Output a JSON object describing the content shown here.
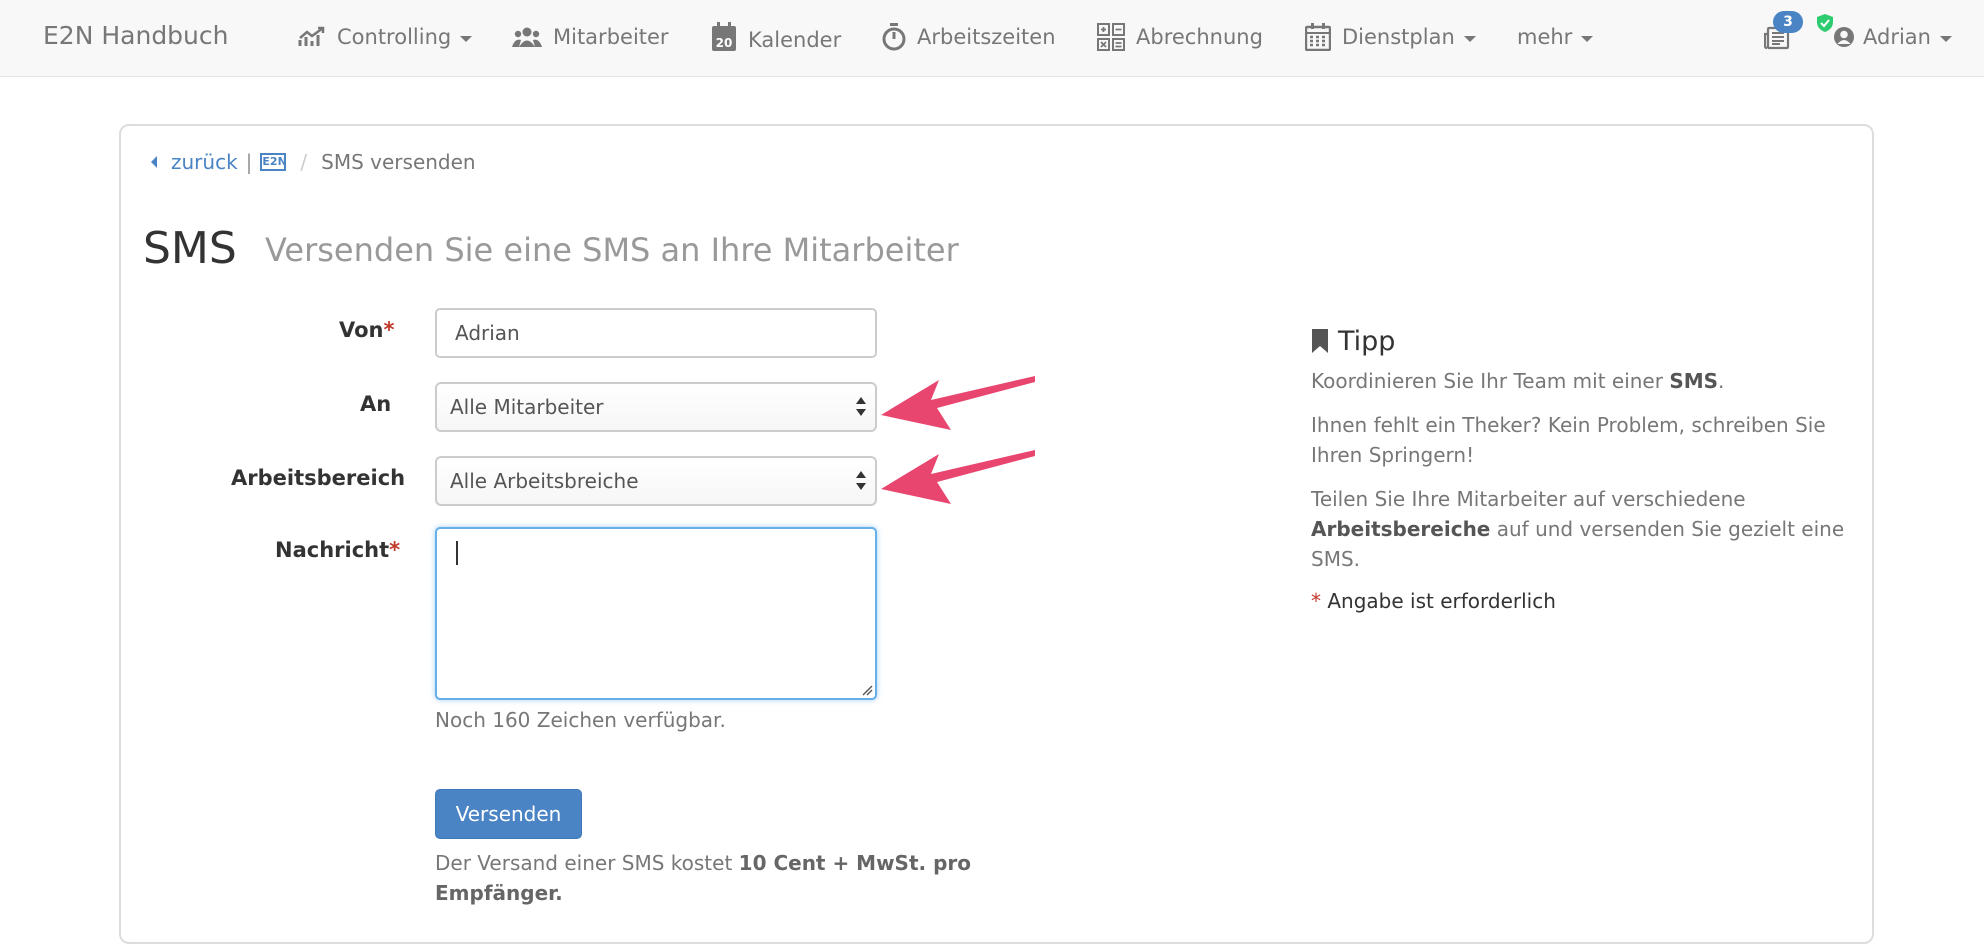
{
  "navbar": {
    "brand": "E2N Handbuch",
    "items": [
      {
        "label": "Controlling",
        "icon": "chart-line-icon",
        "dropdown": true
      },
      {
        "label": "Mitarbeiter",
        "icon": "users-icon",
        "dropdown": false
      },
      {
        "label": "Kalender",
        "icon": "calendar-day-icon",
        "dropdown": false
      },
      {
        "label": "Arbeitszeiten",
        "icon": "stopwatch-icon",
        "dropdown": false
      },
      {
        "label": "Abrechnung",
        "icon": "calculator-icon",
        "dropdown": false
      },
      {
        "label": "Dienstplan",
        "icon": "calendar-grid-icon",
        "dropdown": true
      },
      {
        "label": "mehr",
        "icon": "",
        "dropdown": true
      }
    ],
    "calendar_day": "20",
    "notifications_count": "3",
    "user_name": "Adrian"
  },
  "breadcrumb": {
    "back_label": "zurück",
    "separator": "|",
    "logo_text": "E2N",
    "divider": "/",
    "current": "SMS versenden"
  },
  "page": {
    "title": "SMS",
    "subtitle": "Versenden Sie eine SMS an Ihre Mitarbeiter"
  },
  "form": {
    "from": {
      "label": "Von",
      "required_mark": "*",
      "value": "Adrian"
    },
    "to": {
      "label": "An",
      "selected": "Alle Mitarbeiter"
    },
    "area": {
      "label": "Arbeitsbereich",
      "selected": "Alle Arbeitsbreiche"
    },
    "message": {
      "label": "Nachricht",
      "required_mark": "*",
      "value": ""
    },
    "chars_left": "Noch 160 Zeichen verfügbar.",
    "submit_label": "Versenden",
    "cost_prefix": "Der Versand einer SMS kostet ",
    "cost_bold": "10 Cent + MwSt. pro Empfänger."
  },
  "tip": {
    "title": "Tipp",
    "p1_prefix": "Koordinieren Sie Ihr Team mit einer ",
    "p1_bold": "SMS",
    "p1_suffix": ".",
    "p2": "Ihnen fehlt ein Theker? Kein Problem, schreiben Sie Ihren Springern!",
    "p3_prefix": "Teilen Sie Ihre Mitarbeiter auf verschiedene ",
    "p3_bold": "Arbeitsbereiche",
    "p3_suffix": " auf und versenden Sie gezielt eine SMS.",
    "req_mark": "*",
    "req_text": " Angabe ist erforderlich"
  },
  "colors": {
    "accent": "#4a84c4",
    "required": "#c0392b",
    "annotation_arrow": "#e8456f",
    "navbar_bg": "#f8f8f8"
  }
}
